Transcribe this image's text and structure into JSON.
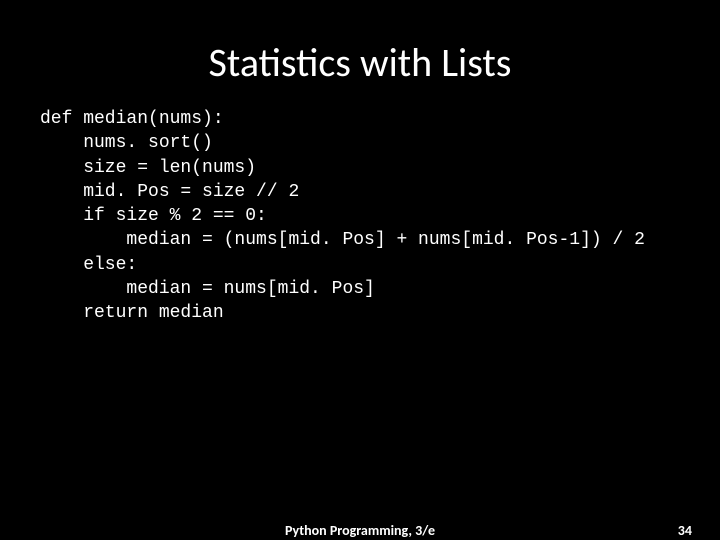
{
  "slide": {
    "title": "Statistics with Lists",
    "code": "def median(nums):\n    nums. sort()\n    size = len(nums)\n    mid. Pos = size // 2\n    if size % 2 == 0:\n        median = (nums[mid. Pos] + nums[mid. Pos-1]) / 2\n    else:\n        median = nums[mid. Pos]\n    return median",
    "footer_center": "Python Programming, 3/e",
    "footer_page": "34"
  }
}
